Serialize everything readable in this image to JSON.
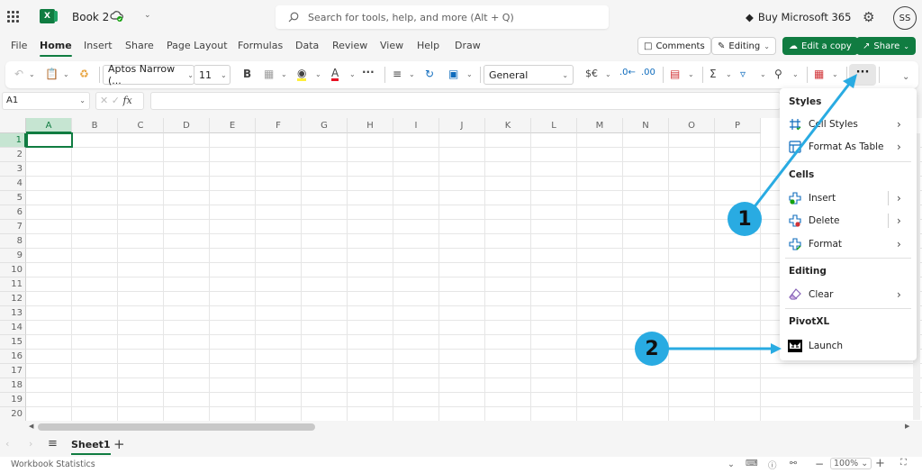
{
  "app": {
    "doc_title": "Book 2",
    "search_placeholder": "Search for tools, help, and more (Alt + Q)",
    "buy_label": "Buy Microsoft 365",
    "avatar_initials": "SS",
    "logo_letter": "X"
  },
  "tabs": [
    {
      "label": "File"
    },
    {
      "label": "Home"
    },
    {
      "label": "Insert"
    },
    {
      "label": "Share"
    },
    {
      "label": "Page Layout"
    },
    {
      "label": "Formulas"
    },
    {
      "label": "Data"
    },
    {
      "label": "Review"
    },
    {
      "label": "View"
    },
    {
      "label": "Help"
    },
    {
      "label": "Draw"
    }
  ],
  "actions": {
    "comments": "Comments",
    "editing": "Editing",
    "edit_copy": "Edit a copy",
    "share": "Share"
  },
  "ribbon": {
    "font_name": "Aptos Narrow (...",
    "font_size": "11",
    "bold": "B",
    "number_format": "General",
    "currency": "$€",
    "more": "···"
  },
  "formula_bar": {
    "name_box": "A1",
    "fx": "fx",
    "value": ""
  },
  "grid": {
    "columns": [
      "A",
      "B",
      "C",
      "D",
      "E",
      "F",
      "G",
      "H",
      "I",
      "J",
      "K",
      "L",
      "M",
      "N",
      "O",
      "P"
    ],
    "rows": [
      "1",
      "2",
      "3",
      "4",
      "5",
      "6",
      "7",
      "8",
      "9",
      "10",
      "11",
      "12",
      "13",
      "14",
      "15",
      "16",
      "17",
      "18",
      "19",
      "20"
    ],
    "selected_cell": "A1"
  },
  "sheets": {
    "tabs": [
      {
        "label": "Sheet1"
      }
    ],
    "add": "+"
  },
  "status": {
    "left": "Workbook Statistics",
    "zoom": "100%"
  },
  "menu": {
    "sections": [
      {
        "header": "Styles",
        "items": [
          {
            "label": "Cell Styles"
          },
          {
            "label": "Format As Table"
          }
        ]
      },
      {
        "header": "Cells",
        "items": [
          {
            "label": "Insert"
          },
          {
            "label": "Delete"
          },
          {
            "label": "Format"
          }
        ]
      },
      {
        "header": "Editing",
        "items": [
          {
            "label": "Clear"
          }
        ]
      },
      {
        "header": "PivotXL",
        "items": [
          {
            "label": "Launch"
          }
        ]
      }
    ]
  },
  "callouts": [
    "1",
    "2"
  ],
  "colors": {
    "accent": "#107c41",
    "callout": "#29abe2"
  }
}
